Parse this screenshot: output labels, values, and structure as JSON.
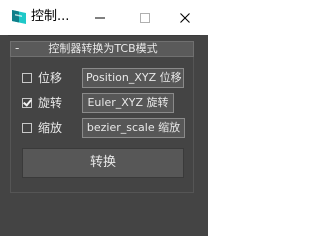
{
  "titlebar": {
    "title": "控制...",
    "minimize_glyph": "—",
    "maximize_glyph": "☐",
    "close_glyph": "✕"
  },
  "rollout": {
    "toggle": "-",
    "title": "控制器转换为TCB模式"
  },
  "options": [
    {
      "label": "位移",
      "checked": false,
      "button_label": "Position_XYZ 位移"
    },
    {
      "label": "旋转",
      "checked": true,
      "button_label": "Euler_XYZ 旋转"
    },
    {
      "label": "缩放",
      "checked": false,
      "button_label": "bezier_scale 缩放"
    }
  ],
  "convert_button": "转换",
  "colors": {
    "app_icon_primary": "#1ec8c8",
    "app_icon_secondary": "#0f7f8a",
    "panel_bg": "#444444",
    "button_bg": "#575757",
    "text": "#e8e8e8"
  },
  "icons": {
    "app": "3ds-max-logo-icon"
  }
}
